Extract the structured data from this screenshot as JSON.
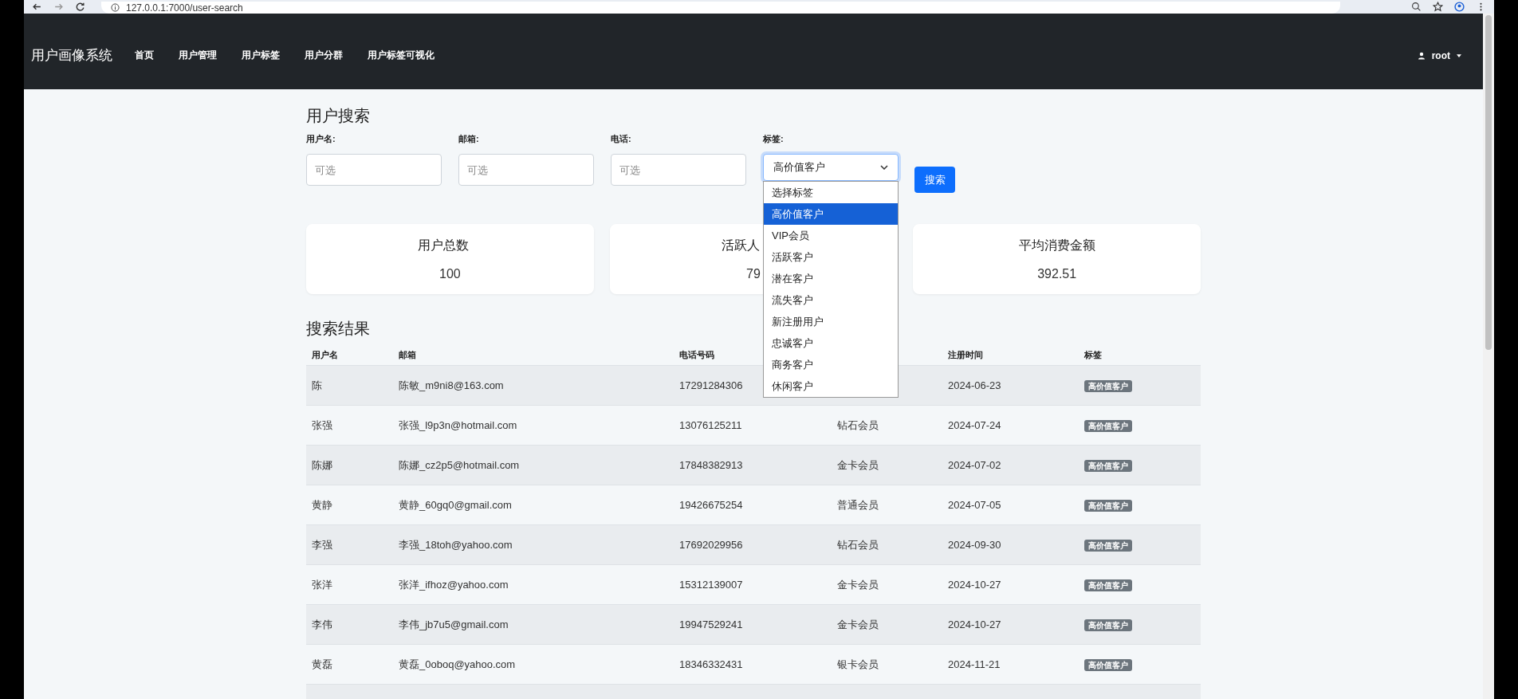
{
  "browser": {
    "url": "127.0.0.1:7000/user-search"
  },
  "navbar": {
    "brand": "用户画像系统",
    "items": [
      "首页",
      "用户管理",
      "用户标签",
      "用户分群",
      "用户标签可视化"
    ],
    "user": "root"
  },
  "search": {
    "title": "用户搜索",
    "fields": [
      {
        "label": "用户名:",
        "placeholder": "可选",
        "kind": "input"
      },
      {
        "label": "邮箱:",
        "placeholder": "可选",
        "kind": "input"
      },
      {
        "label": "电话:",
        "placeholder": "可选",
        "kind": "input"
      },
      {
        "label": "标签:",
        "value": "高价值客户",
        "kind": "select",
        "expanded": true,
        "options": [
          {
            "label": "选择标签",
            "selected": false
          },
          {
            "label": "高价值客户",
            "selected": true
          },
          {
            "label": "VIP会员",
            "selected": false
          },
          {
            "label": "活跃客户",
            "selected": false
          },
          {
            "label": "潜在客户",
            "selected": false
          },
          {
            "label": "流失客户",
            "selected": false
          },
          {
            "label": "新注册用户",
            "selected": false
          },
          {
            "label": "忠诚客户",
            "selected": false
          },
          {
            "label": "商务客户",
            "selected": false
          },
          {
            "label": "休闲客户",
            "selected": false
          }
        ]
      }
    ],
    "button": "搜索"
  },
  "stats": [
    {
      "title": "用户总数",
      "value": "100"
    },
    {
      "title": "活跃人",
      "value": "79"
    },
    {
      "title": "平均消费金额",
      "value": "392.51"
    }
  ],
  "results": {
    "title": "搜索结果",
    "columns": [
      "用户名",
      "邮箱",
      "电话号码",
      null,
      "注册时间",
      "标签"
    ],
    "rows": [
      [
        "陈",
        "陈敏_m9ni8@163.com",
        "17291284306",
        null,
        "2024-06-23",
        "高价值客户"
      ],
      [
        "张强",
        "张强_l9p3n@hotmail.com",
        "13076125211",
        "钻石会员",
        "2024-07-24",
        "高价值客户"
      ],
      [
        "陈娜",
        "陈娜_cz2p5@hotmail.com",
        "17848382913",
        "金卡会员",
        "2024-07-02",
        "高价值客户"
      ],
      [
        "黄静",
        "黄静_60gq0@gmail.com",
        "19426675254",
        "普通会员",
        "2024-07-05",
        "高价值客户"
      ],
      [
        "李强",
        "李强_18toh@yahoo.com",
        "17692029956",
        "钻石会员",
        "2024-09-30",
        "高价值客户"
      ],
      [
        "张洋",
        "张洋_ifhoz@yahoo.com",
        "15312139007",
        "金卡会员",
        "2024-10-27",
        "高价值客户"
      ],
      [
        "李伟",
        "李伟_jb7u5@gmail.com",
        "19947529241",
        "金卡会员",
        "2024-10-27",
        "高价值客户"
      ],
      [
        "黄磊",
        "黄磊_0oboq@yahoo.com",
        "18346332431",
        "银卡会员",
        "2024-11-21",
        "高价值客户"
      ]
    ]
  }
}
